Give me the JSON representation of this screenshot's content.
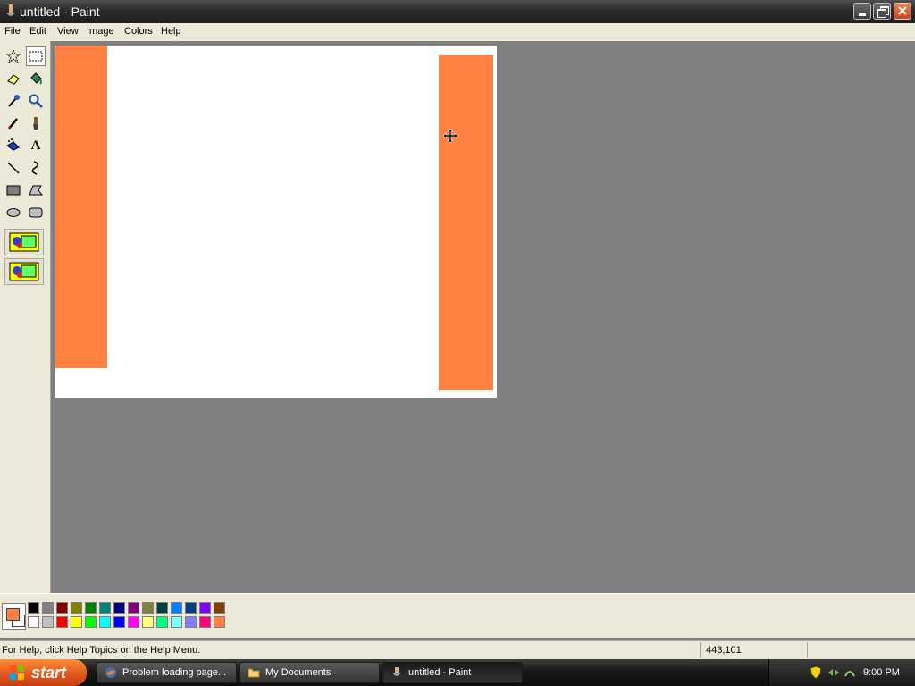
{
  "window": {
    "title": "untitled - Paint"
  },
  "menu": [
    "File",
    "Edit",
    "View",
    "Image",
    "Colors",
    "Help"
  ],
  "tools": {
    "free_select_icon": "star-select-icon",
    "select_icon": "rect-select-icon",
    "eraser_icon": "eraser-icon",
    "fill_icon": "paint-bucket-icon",
    "picker_icon": "color-picker-icon",
    "magnifier_icon": "magnifier-icon",
    "pencil_icon": "pencil-icon",
    "brush_icon": "brush-icon",
    "airbrush_icon": "airbrush-icon",
    "text_icon_glyph": "A",
    "line_icon": "line-icon",
    "curve_icon": "curve-icon",
    "rectangle_icon": "rectangle-icon",
    "polygon_icon": "polygon-icon",
    "ellipse_icon": "ellipse-icon",
    "rounded_rect_icon": "rounded-rect-icon",
    "selected": "select"
  },
  "canvas": {
    "background": "#ffffff",
    "shape_color": "#ff8040"
  },
  "palette": {
    "foreground": "#ff8040",
    "background": "#ffffff",
    "row1": [
      "#000000",
      "#808080",
      "#800000",
      "#808000",
      "#008000",
      "#008080",
      "#000080",
      "#800080",
      "#808040",
      "#004040",
      "#0080ff",
      "#004080",
      "#8000ff",
      "#804000"
    ],
    "row2": [
      "#ffffff",
      "#c0c0c0",
      "#ff0000",
      "#ffff00",
      "#00ff00",
      "#00ffff",
      "#0000ff",
      "#ff00ff",
      "#ffff80",
      "#00ff80",
      "#80ffff",
      "#8080ff",
      "#ff0080",
      "#ff8040"
    ]
  },
  "status": {
    "help_text": "For Help, click Help Topics on the Help Menu.",
    "coords": "443,101"
  },
  "taskbar": {
    "start_label": "start",
    "items": [
      {
        "label": "Problem loading page...",
        "icon": "firefox-icon"
      },
      {
        "label": "My Documents",
        "icon": "folder-icon"
      },
      {
        "label": "untitled - Paint",
        "icon": "paint-icon"
      }
    ],
    "clock": "9:00 PM"
  }
}
